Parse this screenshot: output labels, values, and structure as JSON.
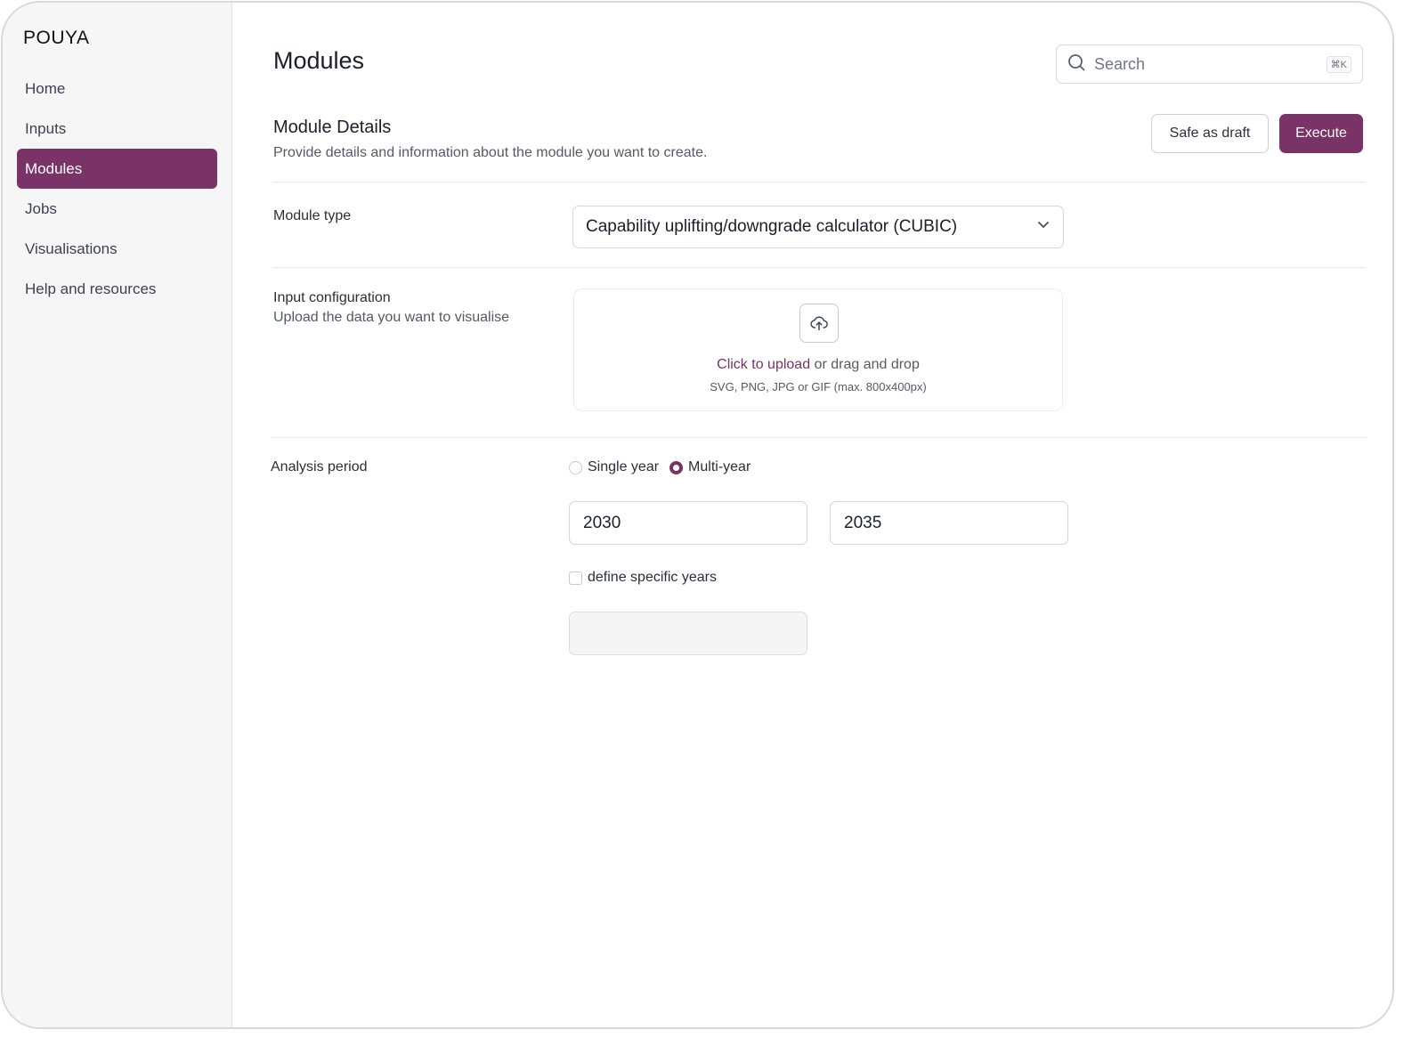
{
  "brand": {
    "name": "POUYA"
  },
  "sidebar": {
    "items": [
      {
        "label": "Home"
      },
      {
        "label": "Inputs"
      },
      {
        "label": "Modules",
        "active": true
      },
      {
        "label": "Jobs"
      },
      {
        "label": "Visualisations"
      },
      {
        "label": "Help and resources"
      }
    ]
  },
  "header": {
    "title": "Modules",
    "search": {
      "placeholder": "Search",
      "shortcut": "⌘K"
    }
  },
  "details": {
    "title": "Module Details",
    "subtitle": "Provide details and information about the module you want to create.",
    "save_draft_label": "Safe as draft",
    "execute_label": "Execute"
  },
  "module_type": {
    "label": "Module type",
    "selected": "Capability uplifting/downgrade calculator (CUBIC)"
  },
  "input_config": {
    "label": "Input configuration",
    "sublabel": "Upload the data you want to visualise",
    "upload_link": "Click to upload",
    "upload_text": "or drag and drop",
    "upload_hint": "SVG, PNG, JPG or GIF (max. 800x400px)"
  },
  "analysis_period": {
    "label": "Analysis period",
    "options": [
      {
        "label": "Single year",
        "selected": false
      },
      {
        "label": "Multi-year",
        "selected": true
      }
    ],
    "start_year": "2030",
    "end_year": "2035",
    "specific_years_label": "define specific years",
    "specific_years_checked": false,
    "specific_years_value": ""
  },
  "colors": {
    "accent": "#7a3366",
    "sidebar_bg": "#f7f6f7"
  }
}
